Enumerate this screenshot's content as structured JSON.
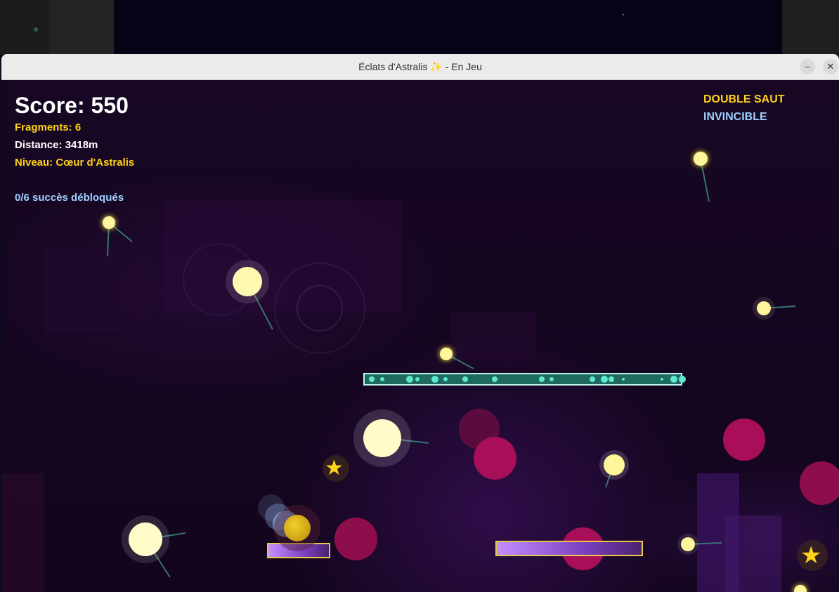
{
  "window": {
    "title": "Éclats d'Astralis ✨ - En Jeu",
    "minimize_label": "–",
    "close_label": "✕"
  },
  "hud": {
    "score": "Score: 550",
    "fragments": "Fragments: 6",
    "distance": "Distance: 3418m",
    "level": "Niveau: Cœur d'Astralis",
    "achievements": "0/6 succès débloqués"
  },
  "powerups": {
    "double_jump": "DOUBLE SAUT",
    "invincible": "INVINCIBLE"
  },
  "icons": {
    "star": "★"
  },
  "colors": {
    "score": "#ffffff",
    "gold": "#ffd21a",
    "blue": "#9fd0ff",
    "hazard": "#a80f58",
    "teal_platform": "#1f6a5f",
    "orb": "#fffbb0"
  }
}
